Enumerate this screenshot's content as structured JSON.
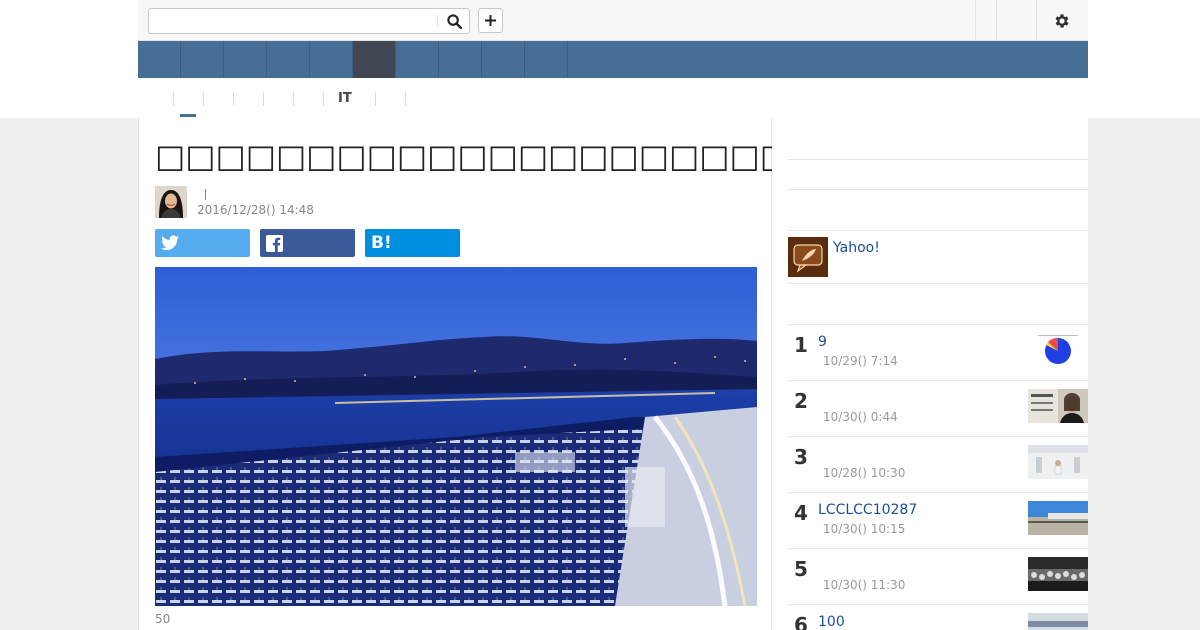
{
  "header": {
    "search": {
      "value": "",
      "placeholder": ""
    },
    "icons": {
      "search": "search-icon",
      "add": "plus-icon",
      "settings": "gear-icon"
    }
  },
  "nav": {
    "tab_count": 10,
    "active_index": 5,
    "colors": {
      "bar": "#476f96",
      "active": "#404652"
    }
  },
  "subnav": {
    "visible_label": "IT"
  },
  "article": {
    "title": "□□□□□□□□□□□□□□□□□□□□□□□□□",
    "date": "2016/12/28() 14:48",
    "share": {
      "twitter_icon": "twitter-icon",
      "facebook_icon": "facebook-icon",
      "hatena_label": "B!"
    },
    "photo_caption": "50"
  },
  "sidebar": {
    "yahoo_link": "Yahoo!",
    "ranking": [
      {
        "rank": "1",
        "title": "9",
        "time": "10/29() 7:14"
      },
      {
        "rank": "2",
        "title": "",
        "time": "10/30() 0:44"
      },
      {
        "rank": "3",
        "title": "",
        "time": "10/28() 10:30"
      },
      {
        "rank": "4",
        "title": "LCCLCC10287",
        "time": "10/30() 10:15"
      },
      {
        "rank": "5",
        "title": "",
        "time": "10/30() 11:30"
      },
      {
        "rank": "6",
        "title": "100",
        "time": ""
      }
    ]
  },
  "colors": {
    "link": "#1a4f9c",
    "twitter": "#55acee",
    "facebook": "#3b5998",
    "hatena": "#008fde"
  }
}
